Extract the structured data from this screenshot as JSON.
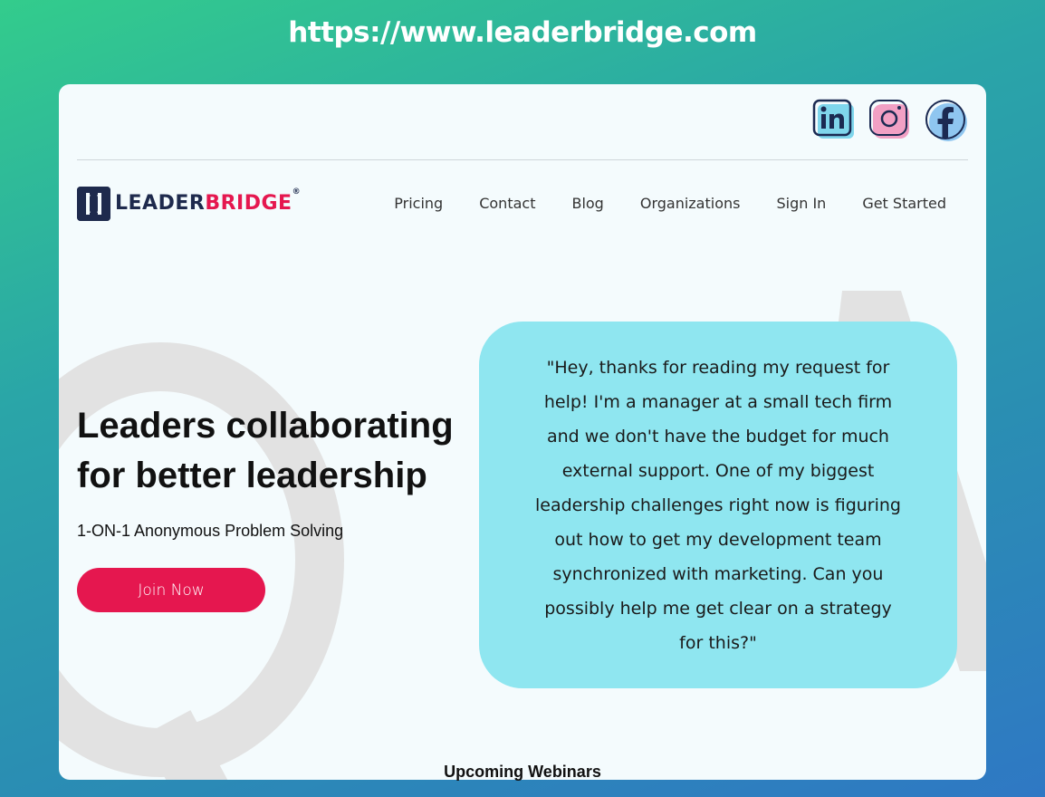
{
  "banner": {
    "url": "https://www.leaderbridge.com"
  },
  "social": [
    {
      "name": "linkedin",
      "icon": "linkedin-icon",
      "color": "#1b2a52"
    },
    {
      "name": "instagram",
      "icon": "instagram-icon",
      "color": "#f2a0c4"
    },
    {
      "name": "facebook",
      "icon": "facebook-icon",
      "color": "#8fc6f0"
    }
  ],
  "logo": {
    "part1": "LEADER",
    "part2": "BRIDGE",
    "reg": "®"
  },
  "nav": {
    "items": [
      "Pricing",
      "Contact",
      "Blog",
      "Organizations",
      "Sign In",
      "Get Started"
    ]
  },
  "hero": {
    "title": "Leaders collaborating for better leadership",
    "subtitle": "1-ON-1 Anonymous Problem Solving",
    "cta": "Join Now"
  },
  "quote": {
    "text": "\"Hey, thanks for reading my request for help! I'm a manager at a small tech firm and we don't have the budget for much external support. One of my biggest leadership challenges right now is figuring out how to get my development team synchronized with marketing. Can you possibly help me get clear on a strategy for this?\""
  },
  "sections": {
    "webinars": "Upcoming Webinars"
  },
  "colors": {
    "brand_navy": "#1e2a4d",
    "brand_red": "#e5174f",
    "quote_bg": "#8fe6f0",
    "card_bg": "#f4fbfd"
  }
}
